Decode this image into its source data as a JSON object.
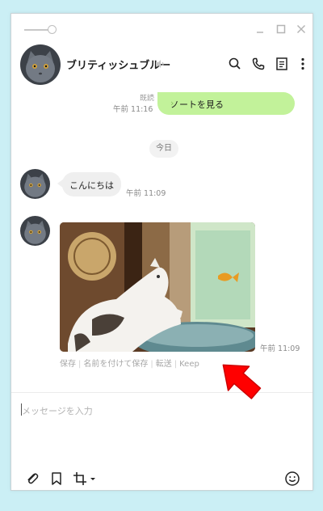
{
  "window": {
    "controls": [
      "minimize-icon",
      "maximize-icon",
      "close-icon"
    ]
  },
  "header": {
    "chat_name": "ブリティッシュブルー",
    "icons": [
      "speaker-muted-icon",
      "search-icon",
      "phone-icon",
      "notes-icon",
      "more-vertical-icon"
    ]
  },
  "messages": {
    "read_label": "既読",
    "first_time": "午前 11:16",
    "note_button_label": "ノートを見る",
    "date_divider": "今日",
    "greeting_text": "こんにちは",
    "greeting_time": "午前 11:09",
    "image_time": "午前 11:09",
    "image_actions": [
      "保存",
      "名前を付けて保存",
      "転送",
      "Keep"
    ]
  },
  "input": {
    "placeholder": "メッセージを入力",
    "toolbar_icons": [
      "paperclip-icon",
      "bookmark-icon",
      "crop-icon",
      "emoji-icon"
    ]
  },
  "colors": {
    "background": "#cbeff5",
    "green_bubble": "#c2f29a",
    "gray_bubble": "#efefef",
    "arrow": "#ff0000"
  }
}
